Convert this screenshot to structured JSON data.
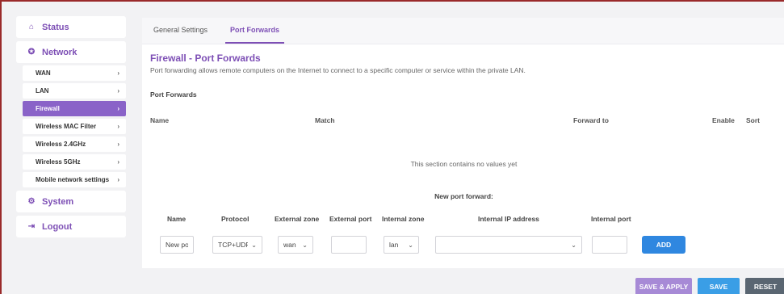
{
  "sidebar": {
    "status": {
      "label": "Status",
      "icon": "home-icon"
    },
    "network": {
      "label": "Network",
      "icon": "globe-icon"
    },
    "network_items": [
      {
        "label": "WAN"
      },
      {
        "label": "LAN"
      },
      {
        "label": "Firewall",
        "active": true
      },
      {
        "label": "Wireless MAC Filter"
      },
      {
        "label": "Wireless 2.4GHz"
      },
      {
        "label": "Wireless 5GHz"
      },
      {
        "label": "Mobile network settings"
      }
    ],
    "system": {
      "label": "System",
      "icon": "gears-icon"
    },
    "logout": {
      "label": "Logout",
      "icon": "logout-icon"
    },
    "chevron": "›"
  },
  "tabs": [
    "General Settings",
    "Port Forwards"
  ],
  "page": {
    "title": "Firewall - Port Forwards",
    "description": "Port forwarding allows remote computers on the Internet to connect to a specific computer or service within the private LAN.",
    "section_title": "Port Forwards",
    "table_headers": {
      "name": "Name",
      "match": "Match",
      "forward_to": "Forward to",
      "enable": "Enable",
      "sort": "Sort"
    },
    "empty_message": "This section contains no values yet"
  },
  "new_forward": {
    "title": "New port forward:",
    "headers": [
      "Name",
      "Protocol",
      "External zone",
      "External port",
      "Internal zone",
      "Internal IP address",
      "Internal port"
    ],
    "name_value": "New po",
    "protocol_value": "TCP+UDP",
    "external_zone_value": "wan",
    "external_port_value": "",
    "internal_zone_value": "lan",
    "internal_ip_value": "",
    "internal_port_value": "",
    "add_label": "ADD"
  },
  "footer": {
    "save_apply": "SAVE & APPLY",
    "save": "SAVE",
    "reset": "RESET"
  },
  "colors": {
    "accent": "#7d4fb5",
    "active_item": "#8a63c8",
    "add_button": "#2f87e0",
    "save_apply": "#a78ad6",
    "save": "#3a9ee6",
    "reset": "#5a6672"
  }
}
